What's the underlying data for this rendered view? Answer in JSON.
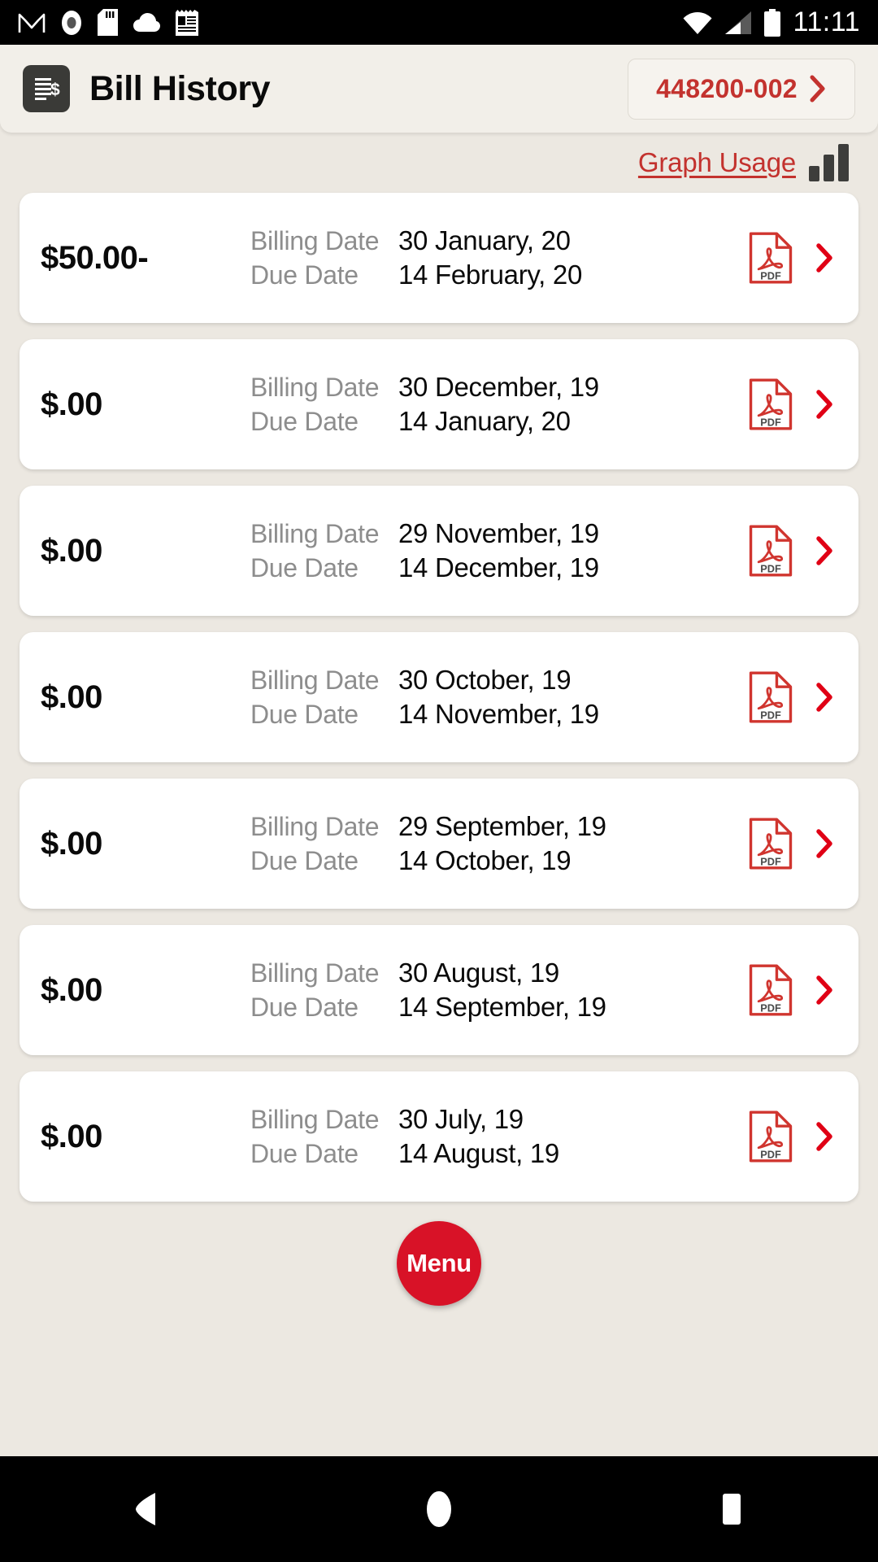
{
  "status_bar": {
    "time": "11:11",
    "left_icons": [
      "gmail-icon",
      "record-icon",
      "sd-card-icon",
      "cloud-icon",
      "notes-icon"
    ],
    "right_icons": [
      "wifi-icon",
      "cellular-signal-icon",
      "battery-icon"
    ]
  },
  "header": {
    "title": "Bill History",
    "icon": "bill-document-icon",
    "account_number": "448200-002",
    "account_chevron": "chevron-right-icon"
  },
  "toolbar": {
    "graph_usage_label": "Graph Usage",
    "graph_icon": "bar-chart-icon"
  },
  "labels": {
    "billing_date": "Billing Date",
    "due_date": "Due Date",
    "pdf_label": "PDF"
  },
  "bills": [
    {
      "amount": "$50.00-",
      "billing_date": "30 January, 20",
      "due_date": "14 February, 20"
    },
    {
      "amount": "$.00",
      "billing_date": "30 December, 19",
      "due_date": "14 January, 20"
    },
    {
      "amount": "$.00",
      "billing_date": "29 November, 19",
      "due_date": "14 December, 19"
    },
    {
      "amount": "$.00",
      "billing_date": "30 October, 19",
      "due_date": "14 November, 19"
    },
    {
      "amount": "$.00",
      "billing_date": "29 September, 19",
      "due_date": "14 October, 19"
    },
    {
      "amount": "$.00",
      "billing_date": "30 August, 19",
      "due_date": "14 September, 19"
    },
    {
      "amount": "$.00",
      "billing_date": "30 July, 19",
      "due_date": "14 August, 19"
    }
  ],
  "fab": {
    "label": "Menu"
  },
  "nav_bar": {
    "back": "back-triangle-icon",
    "home": "home-circle-icon",
    "recents": "recents-square-icon"
  },
  "colors": {
    "accent_red": "#c3322e",
    "fab_red": "#d81227",
    "page_bg": "#ece8e1",
    "header_bg": "#f2efe9",
    "card_bg": "#ffffff",
    "label_gray": "#8d8d8d",
    "text_black": "#0a0a0a",
    "icon_dark": "#3a3a37"
  }
}
